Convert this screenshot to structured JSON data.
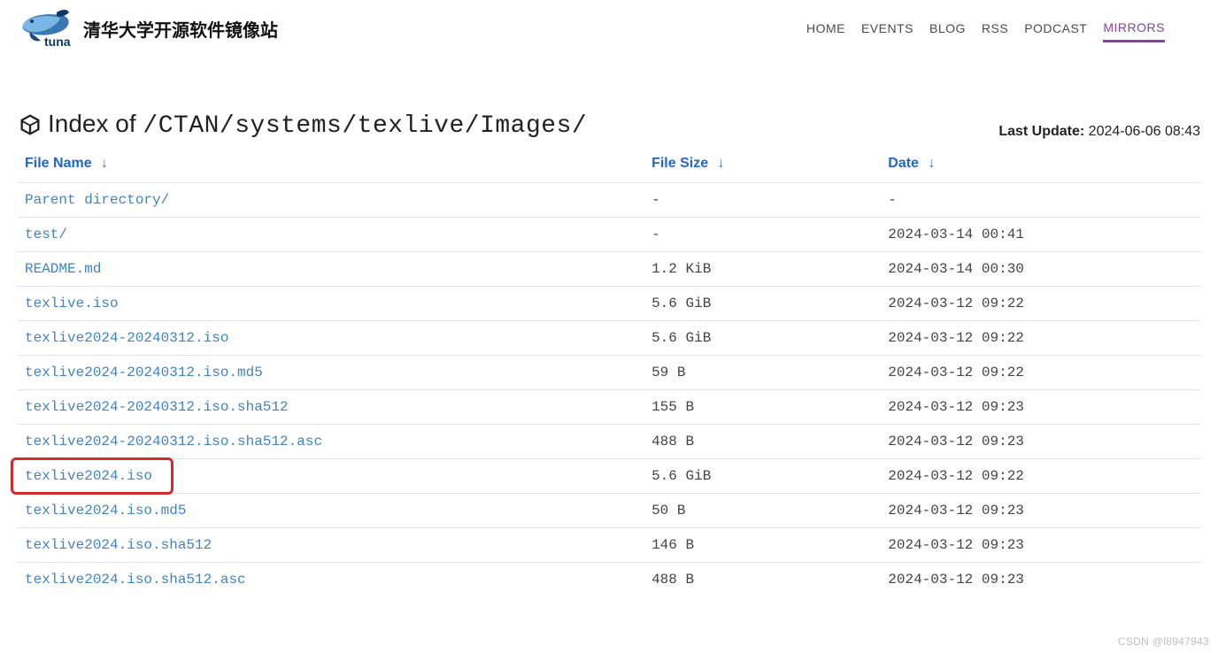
{
  "brand": {
    "site_title": "清华大学开源软件镜像站"
  },
  "nav": {
    "items": [
      {
        "label": "HOME",
        "active": false
      },
      {
        "label": "EVENTS",
        "active": false
      },
      {
        "label": "BLOG",
        "active": false
      },
      {
        "label": "RSS",
        "active": false
      },
      {
        "label": "PODCAST",
        "active": false
      },
      {
        "label": "MIRRORS",
        "active": true
      }
    ]
  },
  "index": {
    "prefix": "Index of ",
    "path": "/CTAN/systems/texlive/Images/"
  },
  "last_update": {
    "label": "Last Update:",
    "value": "2024-06-06 08:43"
  },
  "columns": {
    "name_label": "File Name",
    "size_label": "File Size",
    "date_label": "Date",
    "arrow": "↓"
  },
  "rows": [
    {
      "name": "Parent directory/",
      "size": "-",
      "date": "-",
      "highlight": false
    },
    {
      "name": "test/",
      "size": "-",
      "date": "2024-03-14 00:41",
      "highlight": false
    },
    {
      "name": "README.md",
      "size": "1.2 KiB",
      "date": "2024-03-14 00:30",
      "highlight": false
    },
    {
      "name": "texlive.iso",
      "size": "5.6 GiB",
      "date": "2024-03-12 09:22",
      "highlight": false
    },
    {
      "name": "texlive2024-20240312.iso",
      "size": "5.6 GiB",
      "date": "2024-03-12 09:22",
      "highlight": false
    },
    {
      "name": "texlive2024-20240312.iso.md5",
      "size": "59 B",
      "date": "2024-03-12 09:22",
      "highlight": false
    },
    {
      "name": "texlive2024-20240312.iso.sha512",
      "size": "155 B",
      "date": "2024-03-12 09:23",
      "highlight": false
    },
    {
      "name": "texlive2024-20240312.iso.sha512.asc",
      "size": "488 B",
      "date": "2024-03-12 09:23",
      "highlight": false
    },
    {
      "name": "texlive2024.iso",
      "size": "5.6 GiB",
      "date": "2024-03-12 09:22",
      "highlight": true
    },
    {
      "name": "texlive2024.iso.md5",
      "size": "50 B",
      "date": "2024-03-12 09:23",
      "highlight": false
    },
    {
      "name": "texlive2024.iso.sha512",
      "size": "146 B",
      "date": "2024-03-12 09:23",
      "highlight": false
    },
    {
      "name": "texlive2024.iso.sha512.asc",
      "size": "488 B",
      "date": "2024-03-12 09:23",
      "highlight": false
    }
  ],
  "watermark": "CSDN @l8947943"
}
